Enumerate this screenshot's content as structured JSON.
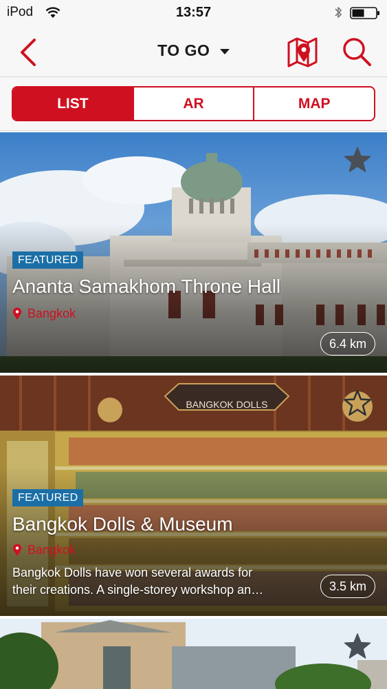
{
  "status_bar": {
    "carrier": "iPod",
    "time": "13:57"
  },
  "nav": {
    "title": "TO GO",
    "icons": [
      "back-chevron-icon",
      "caret-down-icon",
      "map-pin-icon",
      "search-icon"
    ]
  },
  "segments": [
    {
      "label": "LIST",
      "active": true
    },
    {
      "label": "AR",
      "active": false
    },
    {
      "label": "MAP",
      "active": false
    }
  ],
  "colors": {
    "accent": "#cf1020",
    "badge": "#1b6fa6",
    "bar_background": "#f7f7f7"
  },
  "cards": [
    {
      "badge": "FEATURED",
      "title": "Ananta Samakhom Throne Hall",
      "location": "Bangkok",
      "distance": "6.4 km"
    },
    {
      "badge": "FEATURED",
      "title": "Bangkok Dolls & Museum",
      "location": "Bangkok",
      "description_line1": "Bangkok Dolls have won several awards for",
      "description_line2": "their creations.  A single-storey workshop an…",
      "distance": "3.5 km",
      "sign_text": "BANGKOK DOLLS"
    },
    {
      "badge": "",
      "title": "",
      "location": ""
    }
  ]
}
